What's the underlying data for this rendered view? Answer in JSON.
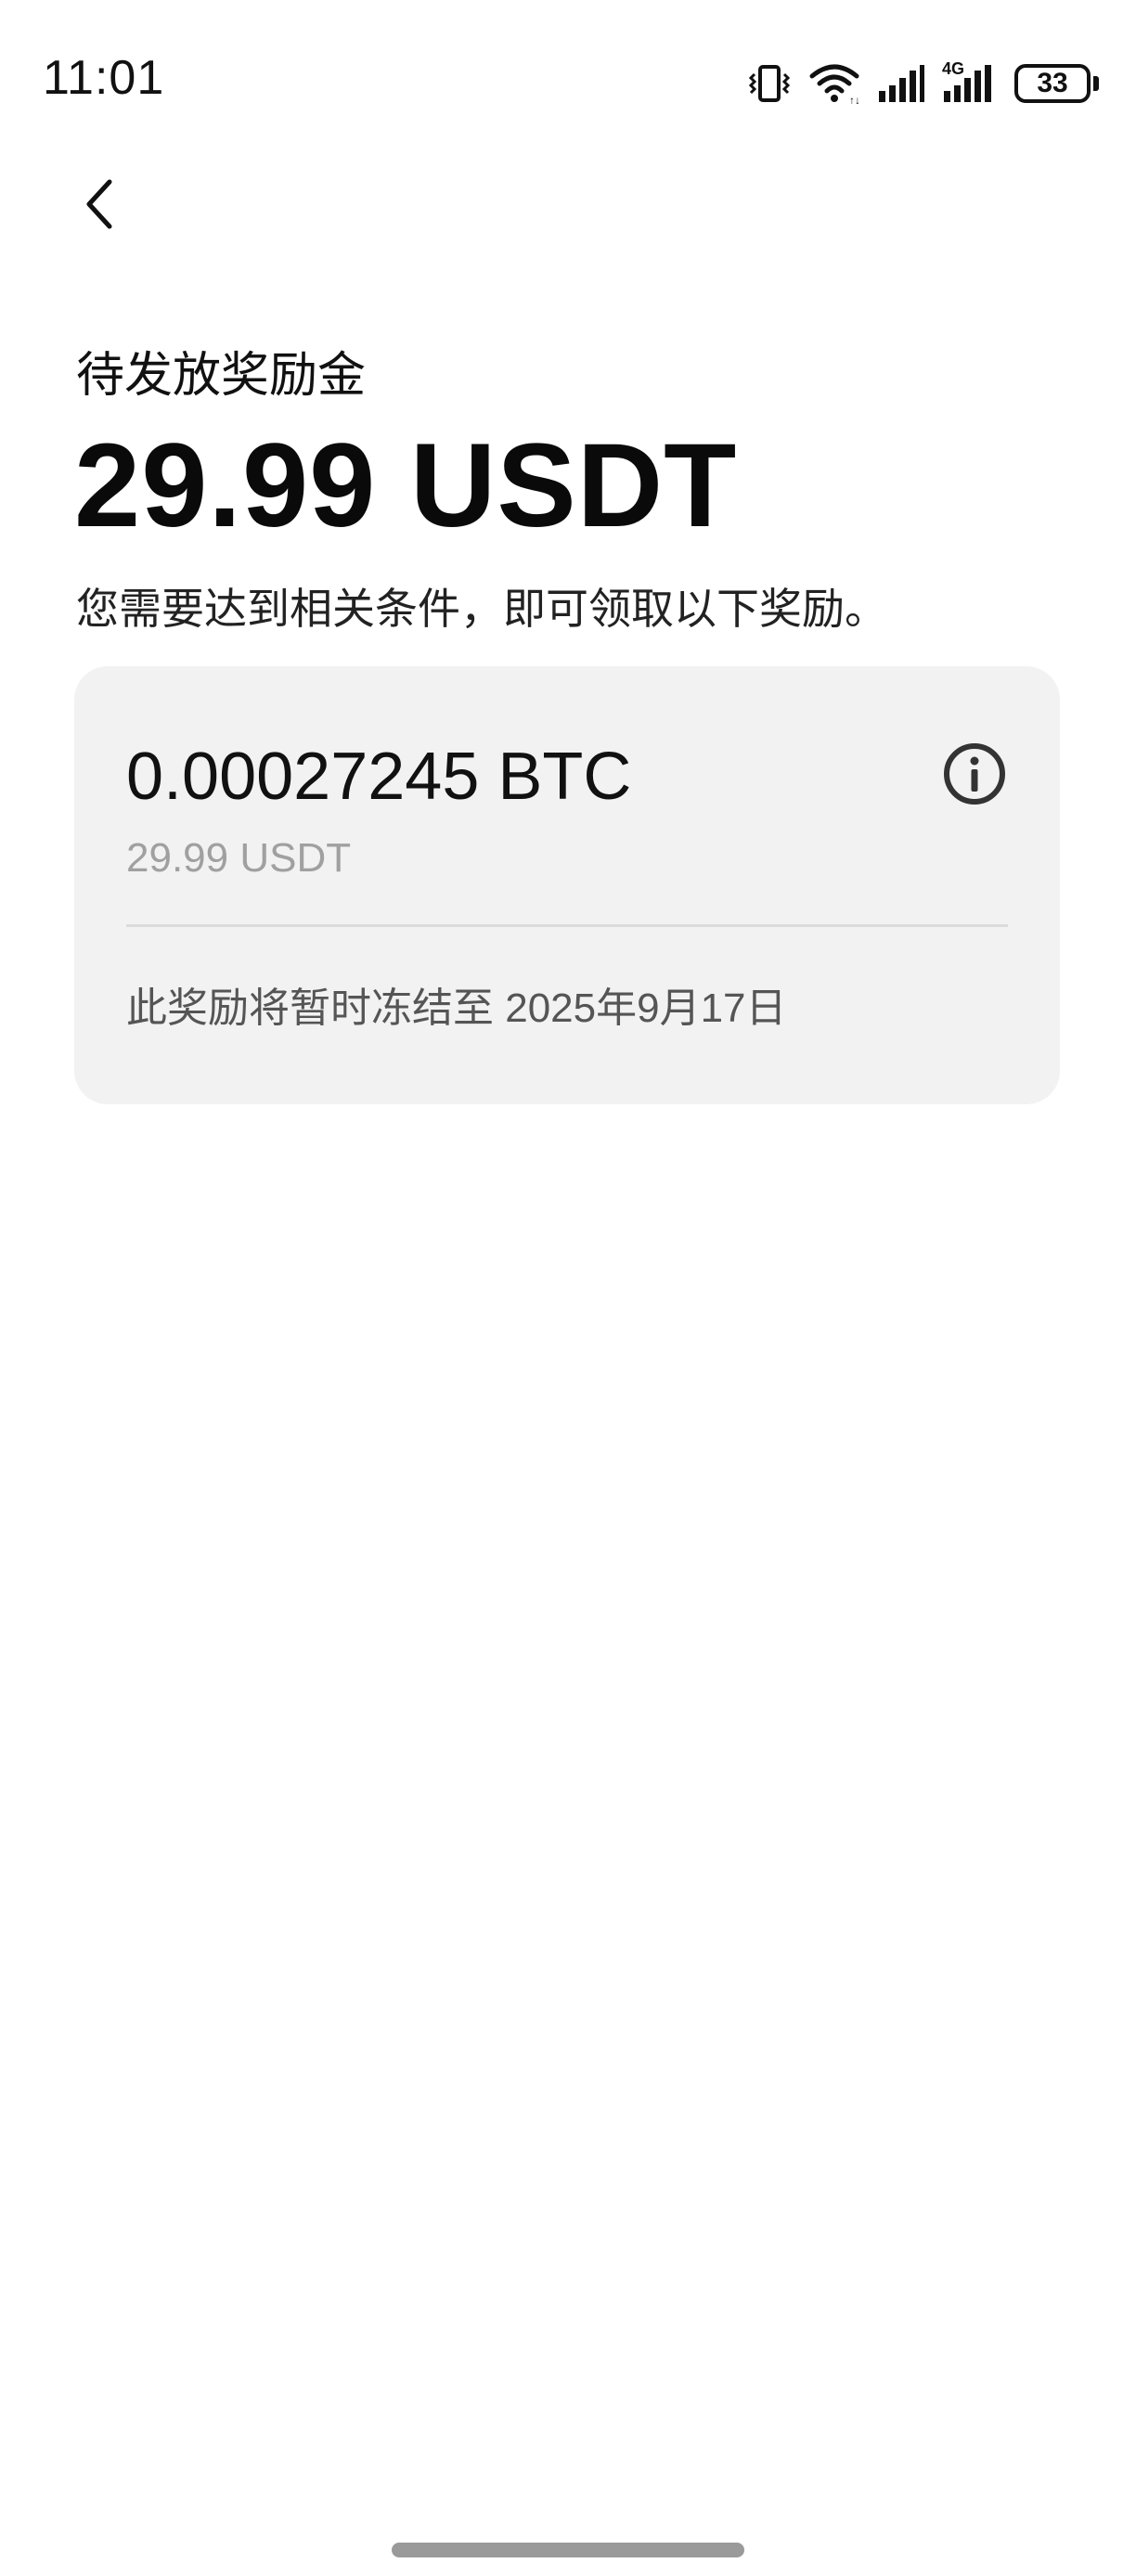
{
  "status_bar": {
    "time": "11:01",
    "network_label": "4G",
    "battery": "33",
    "icons": [
      "vibrate-icon",
      "wifi-icon",
      "signal-icon",
      "signal-4g-icon",
      "battery-icon"
    ]
  },
  "header": {
    "back_icon": "chevron-left-icon"
  },
  "main": {
    "subtitle": "待发放奖励金",
    "amount": "29.99 USDT",
    "instruction": "您需要达到相关条件，即可领取以下奖励。"
  },
  "reward_card": {
    "btc_amount": "0.00027245 BTC",
    "usdt_amount": "29.99 USDT",
    "info_icon": "info-icon",
    "note": "此奖励将暂时冻结至 2025年9月17日"
  },
  "colors": {
    "background": "#ffffff",
    "card_background": "#f2f2f2",
    "primary_text": "#111111",
    "secondary_text": "#a0a0a0"
  }
}
